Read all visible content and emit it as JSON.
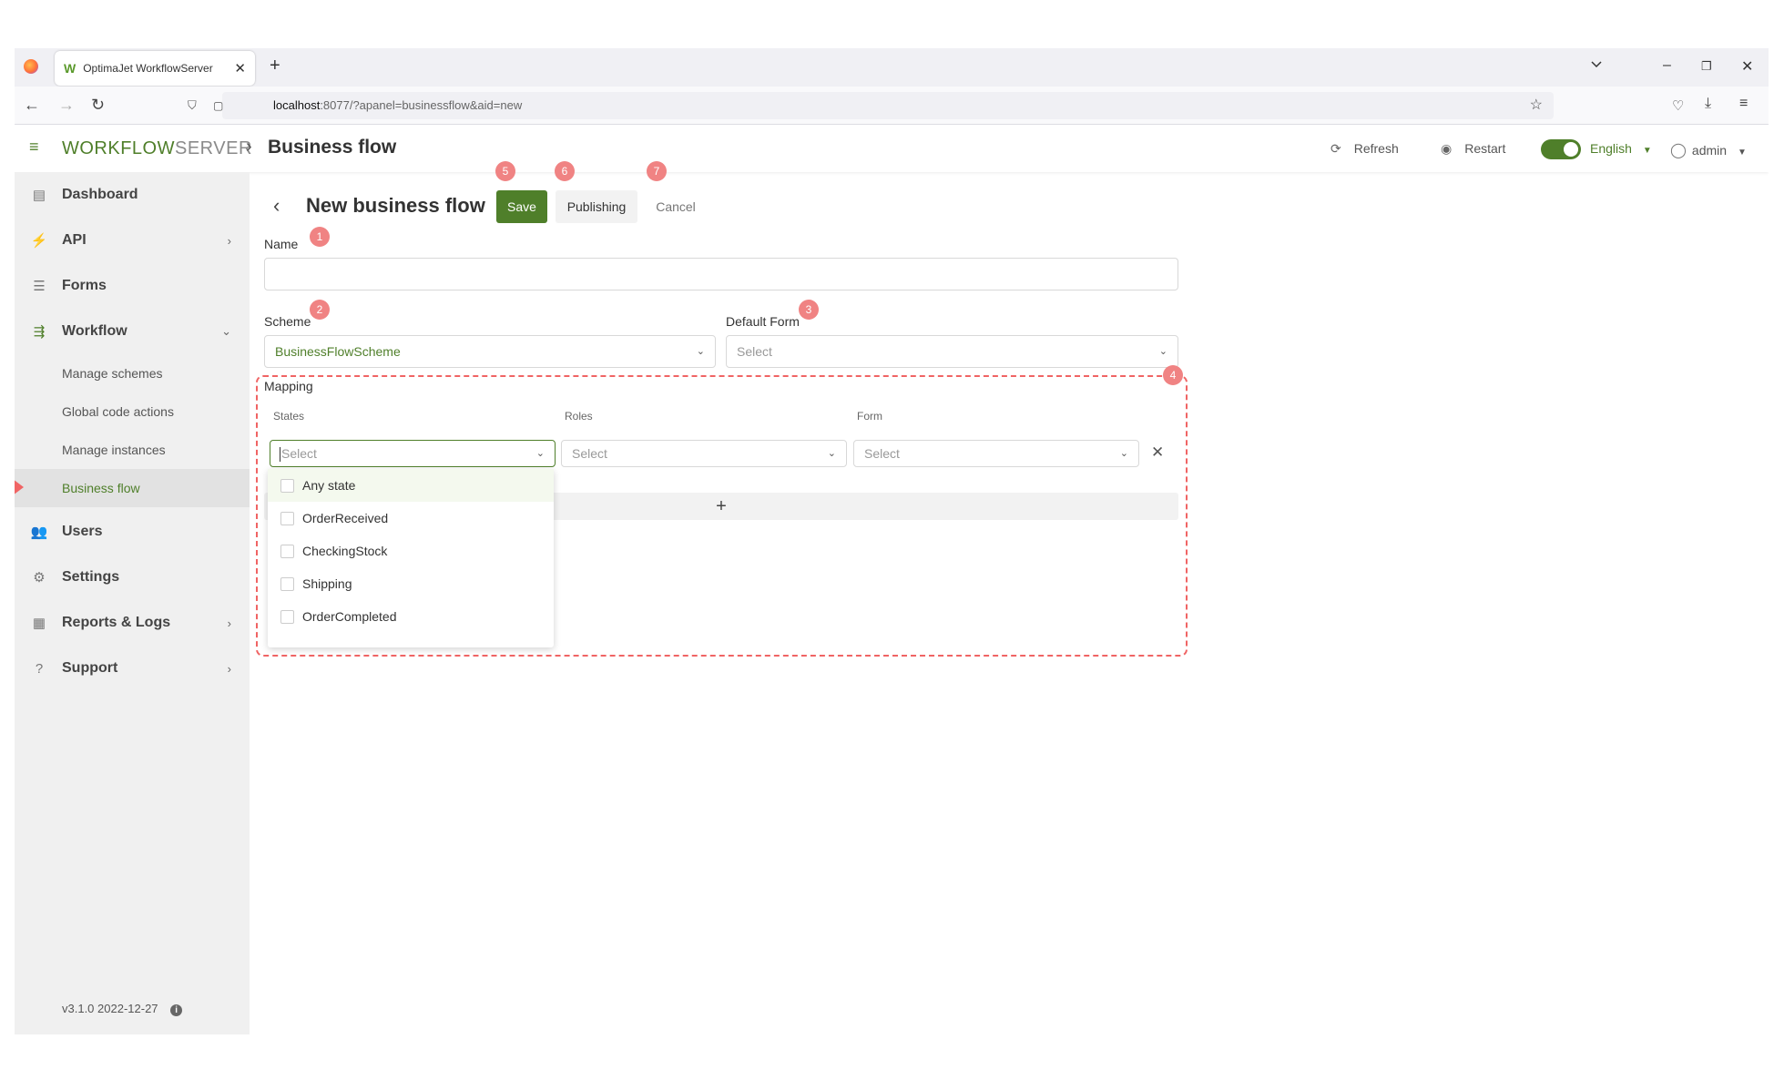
{
  "browser": {
    "tab_title": "OptimaJet WorkflowServer",
    "url_host": "localhost",
    "url_rest": ":8077/?apanel=businessflow&aid=new"
  },
  "app": {
    "brand_workflow": "WORKFLOW",
    "brand_server": "SERVER",
    "page_title": "Business flow",
    "refresh_label": "Refresh",
    "restart_label": "Restart",
    "language": "English",
    "user": "admin"
  },
  "sidebar": {
    "items": [
      {
        "label": "Dashboard"
      },
      {
        "label": "API"
      },
      {
        "label": "Forms"
      },
      {
        "label": "Workflow"
      },
      {
        "label": "Users"
      },
      {
        "label": "Settings"
      },
      {
        "label": "Reports & Logs"
      },
      {
        "label": "Support"
      }
    ],
    "workflow_sub": [
      {
        "label": "Manage schemes"
      },
      {
        "label": "Global code actions"
      },
      {
        "label": "Manage instances"
      },
      {
        "label": "Business flow"
      }
    ],
    "version": "v3.1.0 2022-12-27"
  },
  "form": {
    "title": "New business flow",
    "save_label": "Save",
    "publishing_label": "Publishing",
    "cancel_label": "Cancel",
    "name_label": "Name",
    "name_value": "",
    "scheme_label": "Scheme",
    "scheme_value": "BusinessFlowScheme",
    "default_form_label": "Default Form",
    "default_form_placeholder": "Select",
    "mapping_label": "Mapping",
    "col_states": "States",
    "col_roles": "Roles",
    "col_form": "Form",
    "states_placeholder": "Select",
    "roles_placeholder": "Select",
    "form_placeholder": "Select",
    "add_row": "+",
    "state_options": [
      {
        "label": "Any state"
      },
      {
        "label": "OrderReceived"
      },
      {
        "label": "CheckingStock"
      },
      {
        "label": "Shipping"
      },
      {
        "label": "OrderCompleted"
      }
    ]
  },
  "annotations": {
    "name": "1",
    "scheme": "2",
    "default_form": "3",
    "mapping": "4",
    "save": "5",
    "publishing": "6",
    "cancel": "7"
  },
  "colors": {
    "accent": "#4f7f2a",
    "badge": "#f08383",
    "mapping_border": "#f06464"
  }
}
